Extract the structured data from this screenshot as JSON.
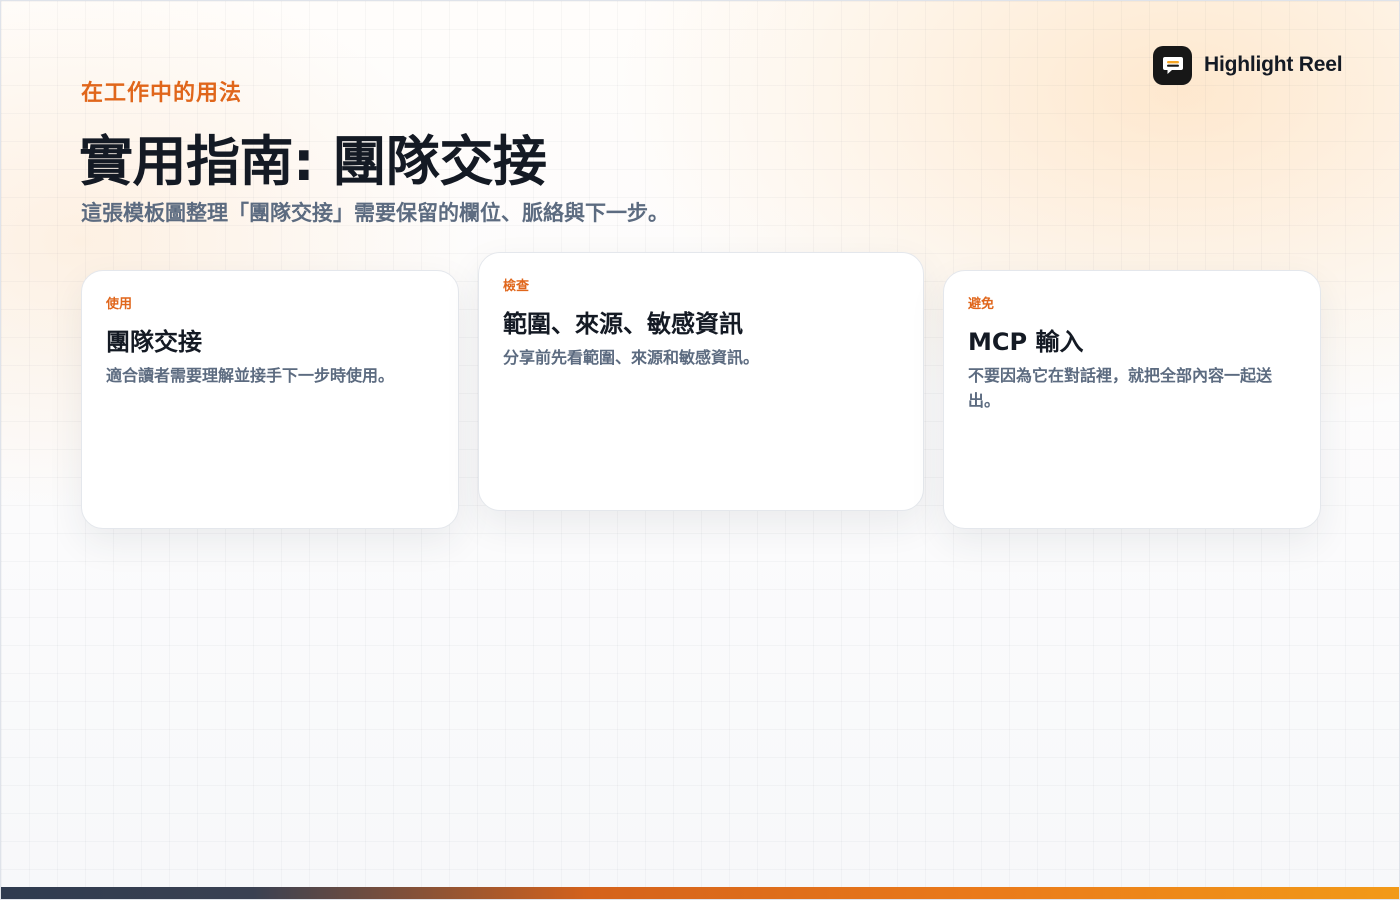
{
  "brand": {
    "name": "Highlight Reel",
    "icon": "chat-bubble-icon",
    "colors": {
      "logo_bg": "#171717",
      "logo_accent": "#f5a524"
    }
  },
  "header": {
    "eyebrow": "在工作中的用法",
    "title": "實用指南: 團隊交接",
    "subtitle": "這張模板圖整理「團隊交接」需要保留的欄位、脈絡與下一步。"
  },
  "cards": [
    {
      "tag": "使用",
      "heading": "團隊交接",
      "body": "適合讀者需要理解並接手下一步時使用。"
    },
    {
      "tag": "檢查",
      "heading": "範圍、來源、敏感資訊",
      "body": "分享前先看範圍、來源和敏感資訊。"
    },
    {
      "tag": "避免",
      "heading": "MCP 輸入",
      "body": "不要因為它在對話裡，就把全部內容一起送出。"
    }
  ],
  "colors": {
    "accent": "#e0661b",
    "text_primary": "#141a24",
    "text_secondary": "#5c6b80"
  }
}
